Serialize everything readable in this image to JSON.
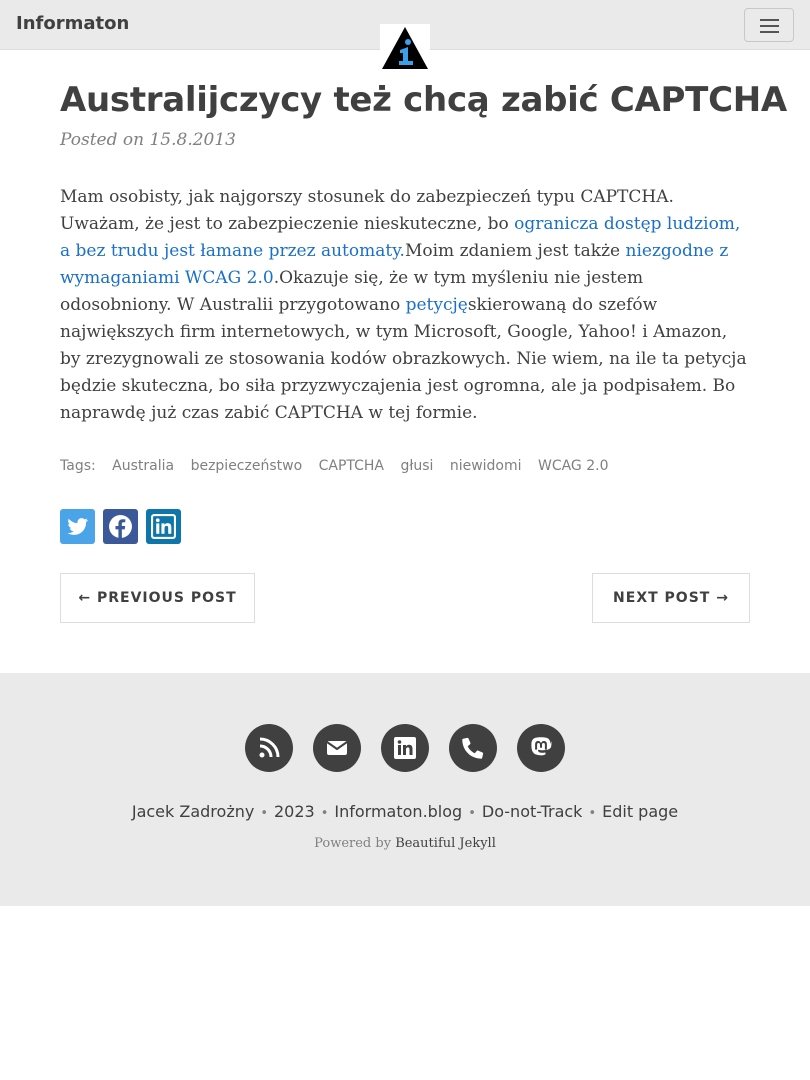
{
  "nav": {
    "brand": "Informaton",
    "menu_icon": "hamburger-icon",
    "logo_icon": "info-triangle-logo"
  },
  "post": {
    "title": "Australijczycy też chcą zabić CAPTCHA",
    "meta": "Posted on 15.8.2013",
    "body": {
      "p1": "Mam osobisty, jak najgorszy stosunek do zabezpieczeń typu CAPTCHA. Uważam, że jest to zabezpieczenie nieskuteczne, bo ",
      "link1": "ogranicza dostęp ludziom, a bez trudu jest łamane przez automaty.",
      "p2": "Moim zdaniem jest także ",
      "link2": "niezgodne z wymaganiami WCAG 2.0",
      "p3": ".Okazuje się, że w tym myśleniu nie jestem odosobniony. W Australii przygotowano ",
      "link3": "petycję",
      "p4": "skierowaną do szefów największych firm internetowych, w tym Microsoft, Google, Yahoo! i Amazon, by zrezygnowali ze stosowania kodów obrazkowych. Nie wiem, na ile ta petycja będzie skuteczna, bo siła przyzwyczajenia jest ogromna, ale ja podpisałem. Bo naprawdę już czas zabić CAPTCHA w tej formie."
    },
    "tags_label": "Tags:",
    "tags": [
      "Australia",
      "bezpieczeństwo",
      "CAPTCHA",
      "głusi",
      "niewidomi",
      "WCAG 2.0"
    ],
    "share_icons": [
      "twitter-icon",
      "facebook-icon",
      "linkedin-icon"
    ],
    "prev_label": "← PREVIOUS POST",
    "next_label": "NEXT POST →"
  },
  "footer": {
    "social_icons": [
      "rss-icon",
      "email-icon",
      "linkedin-icon",
      "phone-icon",
      "mastodon-icon"
    ],
    "author": "Jacek Zadrożny",
    "year": "2023",
    "site": "Informaton.blog",
    "dnt": "Do-not-Track",
    "edit": "Edit page",
    "powered_prefix": "Powered by",
    "powered_link": "Beautiful Jekyll"
  },
  "colors": {
    "link": "#1a6fc9",
    "navbar_bg": "#eaeaea",
    "footer_bg": "#eaeaea",
    "text": "#404040"
  }
}
